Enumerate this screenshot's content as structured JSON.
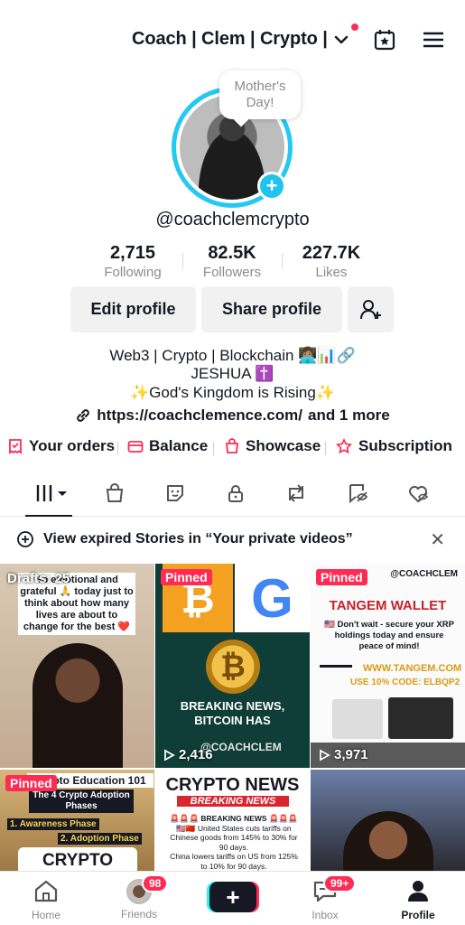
{
  "header": {
    "title": "Coach | Clem | Crypto |",
    "colors": {
      "notification_dot": "#fe2c55"
    }
  },
  "profile": {
    "bubble_line1": "Mother's",
    "bubble_line2": "Day!",
    "username": "@coachclemcrypto",
    "avatar_ring_color": "#25c8f2",
    "stats": [
      {
        "num": "2,715",
        "label": "Following"
      },
      {
        "num": "82.5K",
        "label": "Followers"
      },
      {
        "num": "227.7K",
        "label": "Likes"
      }
    ],
    "edit_profile": "Edit profile",
    "share_profile": "Share profile",
    "bio": [
      "Web3 | Crypto | Blockchain 👩🏽‍💻📊🔗",
      "JESHUA ✝️",
      "✨God's Kingdom is Rising✨"
    ],
    "link": "https://coachclemence.com/",
    "link_more": "and 1 more"
  },
  "quick_links": [
    {
      "label": "Your orders",
      "icon": "receipt-icon"
    },
    {
      "label": "Balance",
      "icon": "wallet-icon"
    },
    {
      "label": "Showcase",
      "icon": "shopping-bag-icon"
    },
    {
      "label": "Subscription",
      "icon": "subscription-icon"
    }
  ],
  "tabs": [
    "videos-grid-icon",
    "shop-bag-icon",
    "stickers-icon",
    "private-lock-icon",
    "repost-icon",
    "favorites-icon",
    "liked-heart-icon"
  ],
  "notice": {
    "text": "View expired Stories in “Your private videos”"
  },
  "grid": [
    {
      "label": "Drafts: 25",
      "pinned": false,
      "views": "",
      "caption": "So emotional and grateful 🙏 today just to think about how many lives are about to change for the best ❤️"
    },
    {
      "label": "Pinned",
      "pinned": true,
      "views": "2,416",
      "caption": "BREAKING NEWS, BITCOIN HAS",
      "watermark": "@COACHCLEM"
    },
    {
      "label": "Pinned",
      "pinned": true,
      "views": "3,971",
      "caption": "TANGEM WALLET",
      "sub": "🇺🇸 Don't wait - secure your XRP holdings today and ensure peace of mind!",
      "url": "WWW.TANGEM.COM",
      "code": "USE 10% CODE: ELBQP2",
      "handle": "@COACHCLEM"
    },
    {
      "label": "Pinned",
      "pinned": true,
      "views": "",
      "caption": "Crypto Education 101",
      "sub": "The 4 Crypto Adoption Phases",
      "items": [
        "1. Awareness Phase",
        "2. Adoption Phase"
      ],
      "big": "CRYPTO"
    },
    {
      "label": "",
      "pinned": false,
      "views": "",
      "caption": "CRYPTO NEWS",
      "sub": "BREAKING NEWS",
      "lines": [
        "🚨🚨🚨 BREAKING NEWS 🚨🚨🚨",
        "🇺🇸🇨🇳 United States cuts tariffs on Chinese goods from 145% to 30% for 90 days.",
        "China lowers tariffs on US from 125% to 10% for 90 days."
      ]
    },
    {
      "label": "",
      "pinned": false,
      "views": "",
      "caption": ""
    }
  ],
  "nav": [
    {
      "label": "Home",
      "icon": "home-icon"
    },
    {
      "label": "Friends",
      "icon": "friends-avatar",
      "badge": "98"
    },
    {
      "label": "",
      "icon": "create-plus-icon"
    },
    {
      "label": "Inbox",
      "icon": "inbox-icon",
      "badge": "99+"
    },
    {
      "label": "Profile",
      "icon": "profile-icon"
    }
  ]
}
